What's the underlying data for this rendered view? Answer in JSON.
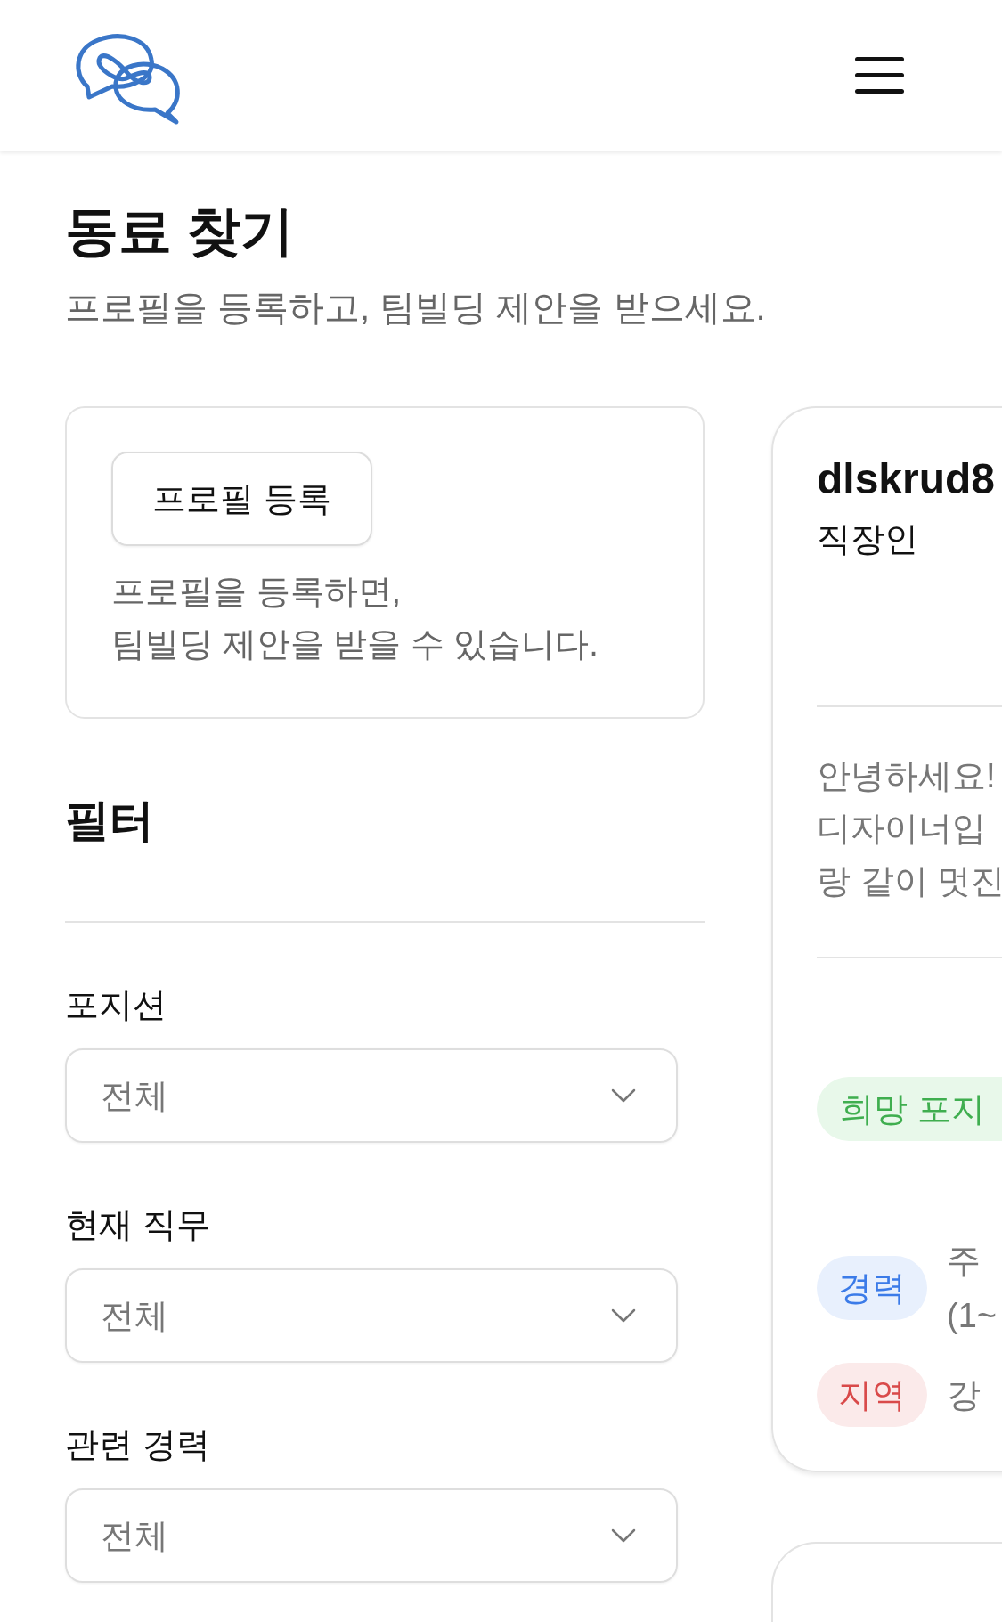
{
  "page": {
    "title": "동료 찾기",
    "subtitle": "프로필을 등록하고, 팀빌딩 제안을 받으세요."
  },
  "register_card": {
    "button": "프로필 등록",
    "description": [
      "프로필을 등록하면,",
      "팀빌딩 제안을 받을 수 있습니다."
    ]
  },
  "filter": {
    "title": "필터",
    "fields": [
      {
        "label": "포지션",
        "value": "전체"
      },
      {
        "label": "현재 직무",
        "value": "전체"
      },
      {
        "label": "관련 경력",
        "value": "전체"
      }
    ]
  },
  "profiles": [
    {
      "kind": "full",
      "username": "dlskrud8",
      "status": "직장인",
      "intro": [
        "안녕하세요!",
        "디자이너입",
        "랑 같이 멋진"
      ],
      "desired_position_tag": "희망 포지",
      "tags": [
        {
          "label": "경력",
          "color": "#3b7be8",
          "value": [
            "주",
            "(1~"
          ]
        },
        {
          "label": "지역",
          "color": "#d94a4a",
          "value": [
            "강"
          ]
        }
      ]
    },
    {
      "kind": "edge"
    }
  ]
}
